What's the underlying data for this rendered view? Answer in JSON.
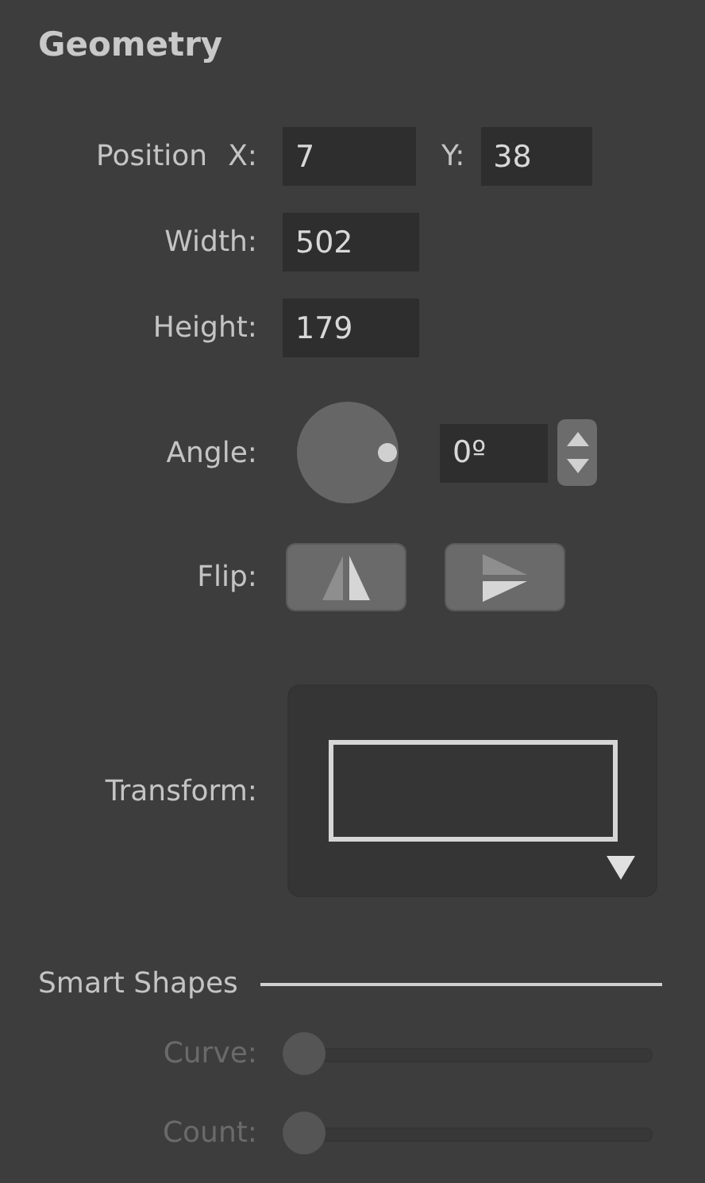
{
  "panel": {
    "title": "Geometry"
  },
  "position": {
    "label": "Position",
    "x_label": "X:",
    "x_value": "7",
    "y_label": "Y:",
    "y_value": "38"
  },
  "size": [
    {
      "label": "Width:",
      "value": "502"
    },
    {
      "label": "Height:",
      "value": "179"
    }
  ],
  "angle": {
    "label": "Angle:",
    "value": "0º"
  },
  "flip": {
    "label": "Flip:"
  },
  "transform": {
    "label": "Transform:"
  },
  "smart_shapes": {
    "title": "Smart Shapes",
    "sliders": [
      {
        "label": "Curve:",
        "level": 0,
        "disabled": true
      },
      {
        "label": "Count:",
        "level": 0,
        "disabled": true
      }
    ]
  }
}
